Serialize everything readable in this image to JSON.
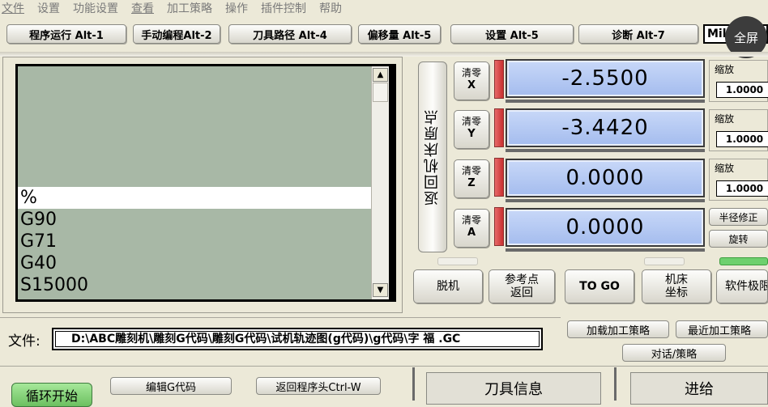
{
  "menu": [
    "文件",
    "设置",
    "功能设置",
    "查看",
    "加工策略",
    "操作",
    "插件控制",
    "帮助"
  ],
  "tabs": [
    "程序运行 Alt-1",
    "手动编程Alt-2",
    "刀具路径 Alt-4",
    "偏移量 Alt-5",
    "设置 Alt-5",
    "诊断 Alt-7"
  ],
  "mil_label": "Mil",
  "fullscreen_label": "全屏",
  "gcode_lines": [
    "%",
    "G90",
    "G71",
    "G40",
    "S15000"
  ],
  "home_label": "返回机床原点",
  "axes": [
    {
      "zero_label": "清零",
      "axis": "X",
      "value": "-2.5500"
    },
    {
      "zero_label": "清零",
      "axis": "Y",
      "value": "-3.4420"
    },
    {
      "zero_label": "清零",
      "axis": "Z",
      "value": "0.0000"
    },
    {
      "zero_label": "清零",
      "axis": "A",
      "value": "0.0000"
    }
  ],
  "scales": [
    {
      "label": "缩放",
      "value": "1.0000"
    },
    {
      "label": "缩放",
      "value": "1.0000"
    },
    {
      "label": "缩放",
      "value": "1.0000"
    }
  ],
  "radius_comp_label": "半径修正",
  "rotate_label": "旋转",
  "buttons": {
    "offline": "脱机",
    "ref_return_1": "参考点",
    "ref_return_2": "返回",
    "to_go": "TO GO",
    "machine_coords_1": "机床",
    "machine_coords_2": "坐标",
    "soft_limit": "软件极限"
  },
  "file": {
    "label": "文件:",
    "path": "D:\\ABC雕刻机\\雕刻G代码\\雕刻G代码\\试机轨迹图(g代码)\\g代码\\字 福 .GC"
  },
  "strategy": {
    "load": "加载加工策略",
    "recent": "最近加工策略",
    "dialog": "对话/策略"
  },
  "bottom": {
    "cycle_start": "循环开始",
    "edit_gcode": "编辑G代码",
    "rewind": "返回程序头Ctrl-W",
    "tool_info": "刀具信息",
    "feed": "进给"
  }
}
